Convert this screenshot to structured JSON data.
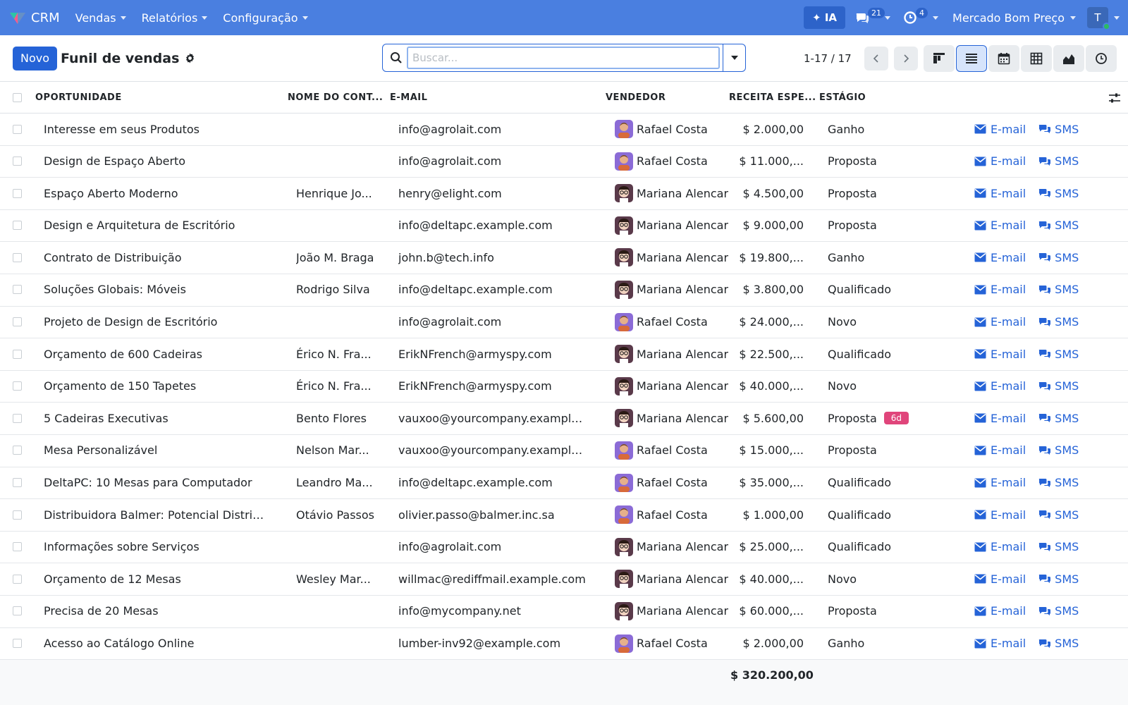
{
  "navbar": {
    "app_name": "CRM",
    "menu": [
      "Vendas",
      "Relatórios",
      "Configuração"
    ],
    "ia_label": "✦ IA",
    "messages_count": "21",
    "activities_count": "4",
    "company": "Mercado Bom Preço",
    "user_initial": "T"
  },
  "control": {
    "new_label": "Novo",
    "title": "Funil de vendas",
    "search_placeholder": "Buscar...",
    "pager": "1-17 / 17"
  },
  "columns": {
    "opportunity": "OPORTUNIDADE",
    "contact": "NOME DO CONT...",
    "email": "E-MAIL",
    "seller": "VENDEDOR",
    "revenue": "RECEITA ESPE...",
    "stage": "ESTÁGIO"
  },
  "actions": {
    "email": "E-mail",
    "sms": "SMS"
  },
  "rows": [
    {
      "opportunity": "Interesse em seus Produtos",
      "contact": "",
      "email": "info@agrolait.com",
      "seller": "Rafael Costa",
      "revenue": "$ 2.000,00",
      "stage": "Ganho",
      "badge": ""
    },
    {
      "opportunity": "Design de Espaço Aberto",
      "contact": "",
      "email": "info@agrolait.com",
      "seller": "Rafael Costa",
      "revenue": "$ 11.000,...",
      "stage": "Proposta",
      "badge": ""
    },
    {
      "opportunity": "Espaço Aberto Moderno",
      "contact": "Henrique Jo...",
      "email": "henry@elight.com",
      "seller": "Mariana Alencar",
      "revenue": "$ 4.500,00",
      "stage": "Proposta",
      "badge": ""
    },
    {
      "opportunity": "Design e Arquitetura de Escritório",
      "contact": "",
      "email": "info@deltapc.example.com",
      "seller": "Mariana Alencar",
      "revenue": "$ 9.000,00",
      "stage": "Proposta",
      "badge": ""
    },
    {
      "opportunity": "Contrato de Distribuição",
      "contact": "João M. Braga",
      "email": "john.b@tech.info",
      "seller": "Mariana Alencar",
      "revenue": "$ 19.800,...",
      "stage": "Ganho",
      "badge": ""
    },
    {
      "opportunity": "Soluções Globais: Móveis",
      "contact": "Rodrigo Silva",
      "email": "info@deltapc.example.com",
      "seller": "Mariana Alencar",
      "revenue": "$ 3.800,00",
      "stage": "Qualificado",
      "badge": ""
    },
    {
      "opportunity": "Projeto de Design de Escritório",
      "contact": "",
      "email": "info@agrolait.com",
      "seller": "Rafael Costa",
      "revenue": "$ 24.000,...",
      "stage": "Novo",
      "badge": ""
    },
    {
      "opportunity": "Orçamento de 600 Cadeiras",
      "contact": "Érico N. Fra...",
      "email": "ErikNFrench@armyspy.com",
      "seller": "Mariana Alencar",
      "revenue": "$ 22.500,...",
      "stage": "Qualificado",
      "badge": ""
    },
    {
      "opportunity": "Orçamento de 150 Tapetes",
      "contact": "Érico N. Fra...",
      "email": "ErikNFrench@armyspy.com",
      "seller": "Mariana Alencar",
      "revenue": "$ 40.000,...",
      "stage": "Novo",
      "badge": ""
    },
    {
      "opportunity": "5 Cadeiras Executivas",
      "contact": "Bento Flores",
      "email": "vauxoo@yourcompany.example....",
      "seller": "Mariana Alencar",
      "revenue": "$ 5.600,00",
      "stage": "Proposta",
      "badge": "6d"
    },
    {
      "opportunity": "Mesa Personalizável",
      "contact": "Nelson Mar...",
      "email": "vauxoo@yourcompany.example....",
      "seller": "Rafael Costa",
      "revenue": "$ 15.000,...",
      "stage": "Proposta",
      "badge": ""
    },
    {
      "opportunity": "DeltaPC: 10 Mesas para Computador",
      "contact": "Leandro Ma...",
      "email": "info@deltapc.example.com",
      "seller": "Rafael Costa",
      "revenue": "$ 35.000,...",
      "stage": "Qualificado",
      "badge": ""
    },
    {
      "opportunity": "Distribuidora Balmer: Potencial Distrib...",
      "contact": "Otávio Passos",
      "email": "olivier.passo@balmer.inc.sa",
      "seller": "Rafael Costa",
      "revenue": "$ 1.000,00",
      "stage": "Qualificado",
      "badge": ""
    },
    {
      "opportunity": "Informações sobre Serviços",
      "contact": "",
      "email": "info@agrolait.com",
      "seller": "Mariana Alencar",
      "revenue": "$ 25.000,...",
      "stage": "Qualificado",
      "badge": ""
    },
    {
      "opportunity": "Orçamento de 12 Mesas",
      "contact": "Wesley Mar...",
      "email": "willmac@rediffmail.example.com",
      "seller": "Mariana Alencar",
      "revenue": "$ 40.000,...",
      "stage": "Novo",
      "badge": ""
    },
    {
      "opportunity": "Precisa de 20 Mesas",
      "contact": "",
      "email": "info@mycompany.net",
      "seller": "Mariana Alencar",
      "revenue": "$ 60.000,...",
      "stage": "Proposta",
      "badge": ""
    },
    {
      "opportunity": "Acesso ao Catálogo Online",
      "contact": "",
      "email": "lumber-inv92@example.com",
      "seller": "Rafael Costa",
      "revenue": "$ 2.000,00",
      "stage": "Ganho",
      "badge": ""
    }
  ],
  "total": "$ 320.200,00"
}
